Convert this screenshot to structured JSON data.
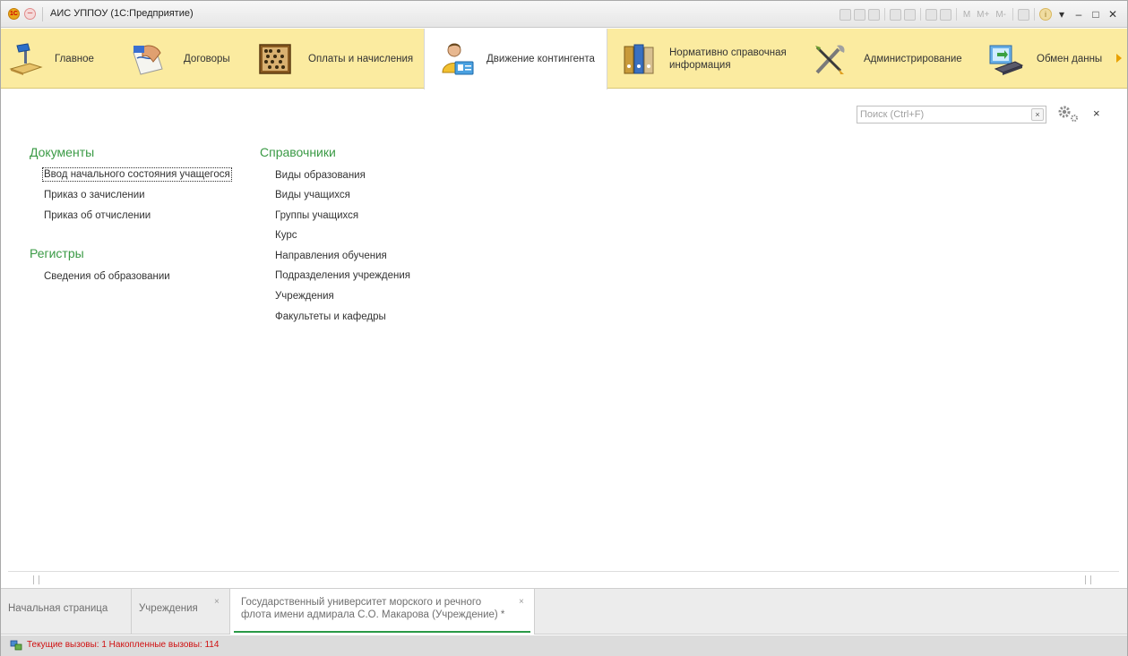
{
  "window": {
    "title": "АИС УППОУ  (1С:Предприятие)",
    "toolbar_labels": [
      "M",
      "M+",
      "M-"
    ]
  },
  "sections": [
    {
      "label": "Главное",
      "icon": "desk-lamp-icon"
    },
    {
      "label": "Договоры",
      "icon": "signing-hand-icon"
    },
    {
      "label": "Оплаты и начисления",
      "icon": "abacus-icon"
    },
    {
      "label": "Движение контингента",
      "icon": "person-card-icon",
      "active": true
    },
    {
      "label_line1": "Нормативно справочная",
      "label_line2": "информация",
      "icon": "binders-icon"
    },
    {
      "label": "Администрирование",
      "icon": "tools-icon"
    },
    {
      "label": "Обмен данны",
      "icon": "data-exchange-icon"
    }
  ],
  "search": {
    "placeholder": "Поиск (Ctrl+F)",
    "clear": "×"
  },
  "content_close": "×",
  "groups": {
    "documents": {
      "title": "Документы",
      "items": [
        "Ввод начального состояния учащегося",
        "Приказ о зачислении",
        "Приказ об отчислении"
      ]
    },
    "registers": {
      "title": "Регистры",
      "items": [
        "Сведения об образовании"
      ]
    },
    "catalogs": {
      "title": "Справочники",
      "items": [
        "Виды образования",
        "Виды учащихся",
        "Группы учащихся",
        "Курс",
        "Направления обучения",
        "Подразделения учреждения",
        "Учреждения",
        "Факультеты и кафедры"
      ]
    }
  },
  "open_windows": [
    {
      "label": "Начальная страница"
    },
    {
      "label": "Учреждения",
      "close": "×"
    },
    {
      "label_line1": "Государственный университет морского и речного",
      "label_line2": "флота имени адмирала С.О. Макарова (Учреждение) *",
      "close": "×",
      "active": true
    }
  ],
  "status": {
    "text": "Текущие вызовы: 1   Накопленные вызовы: 114",
    "color": "#d01010"
  },
  "colors": {
    "accent_green": "#3a9a45",
    "sections_bg": "#fbeba0"
  }
}
